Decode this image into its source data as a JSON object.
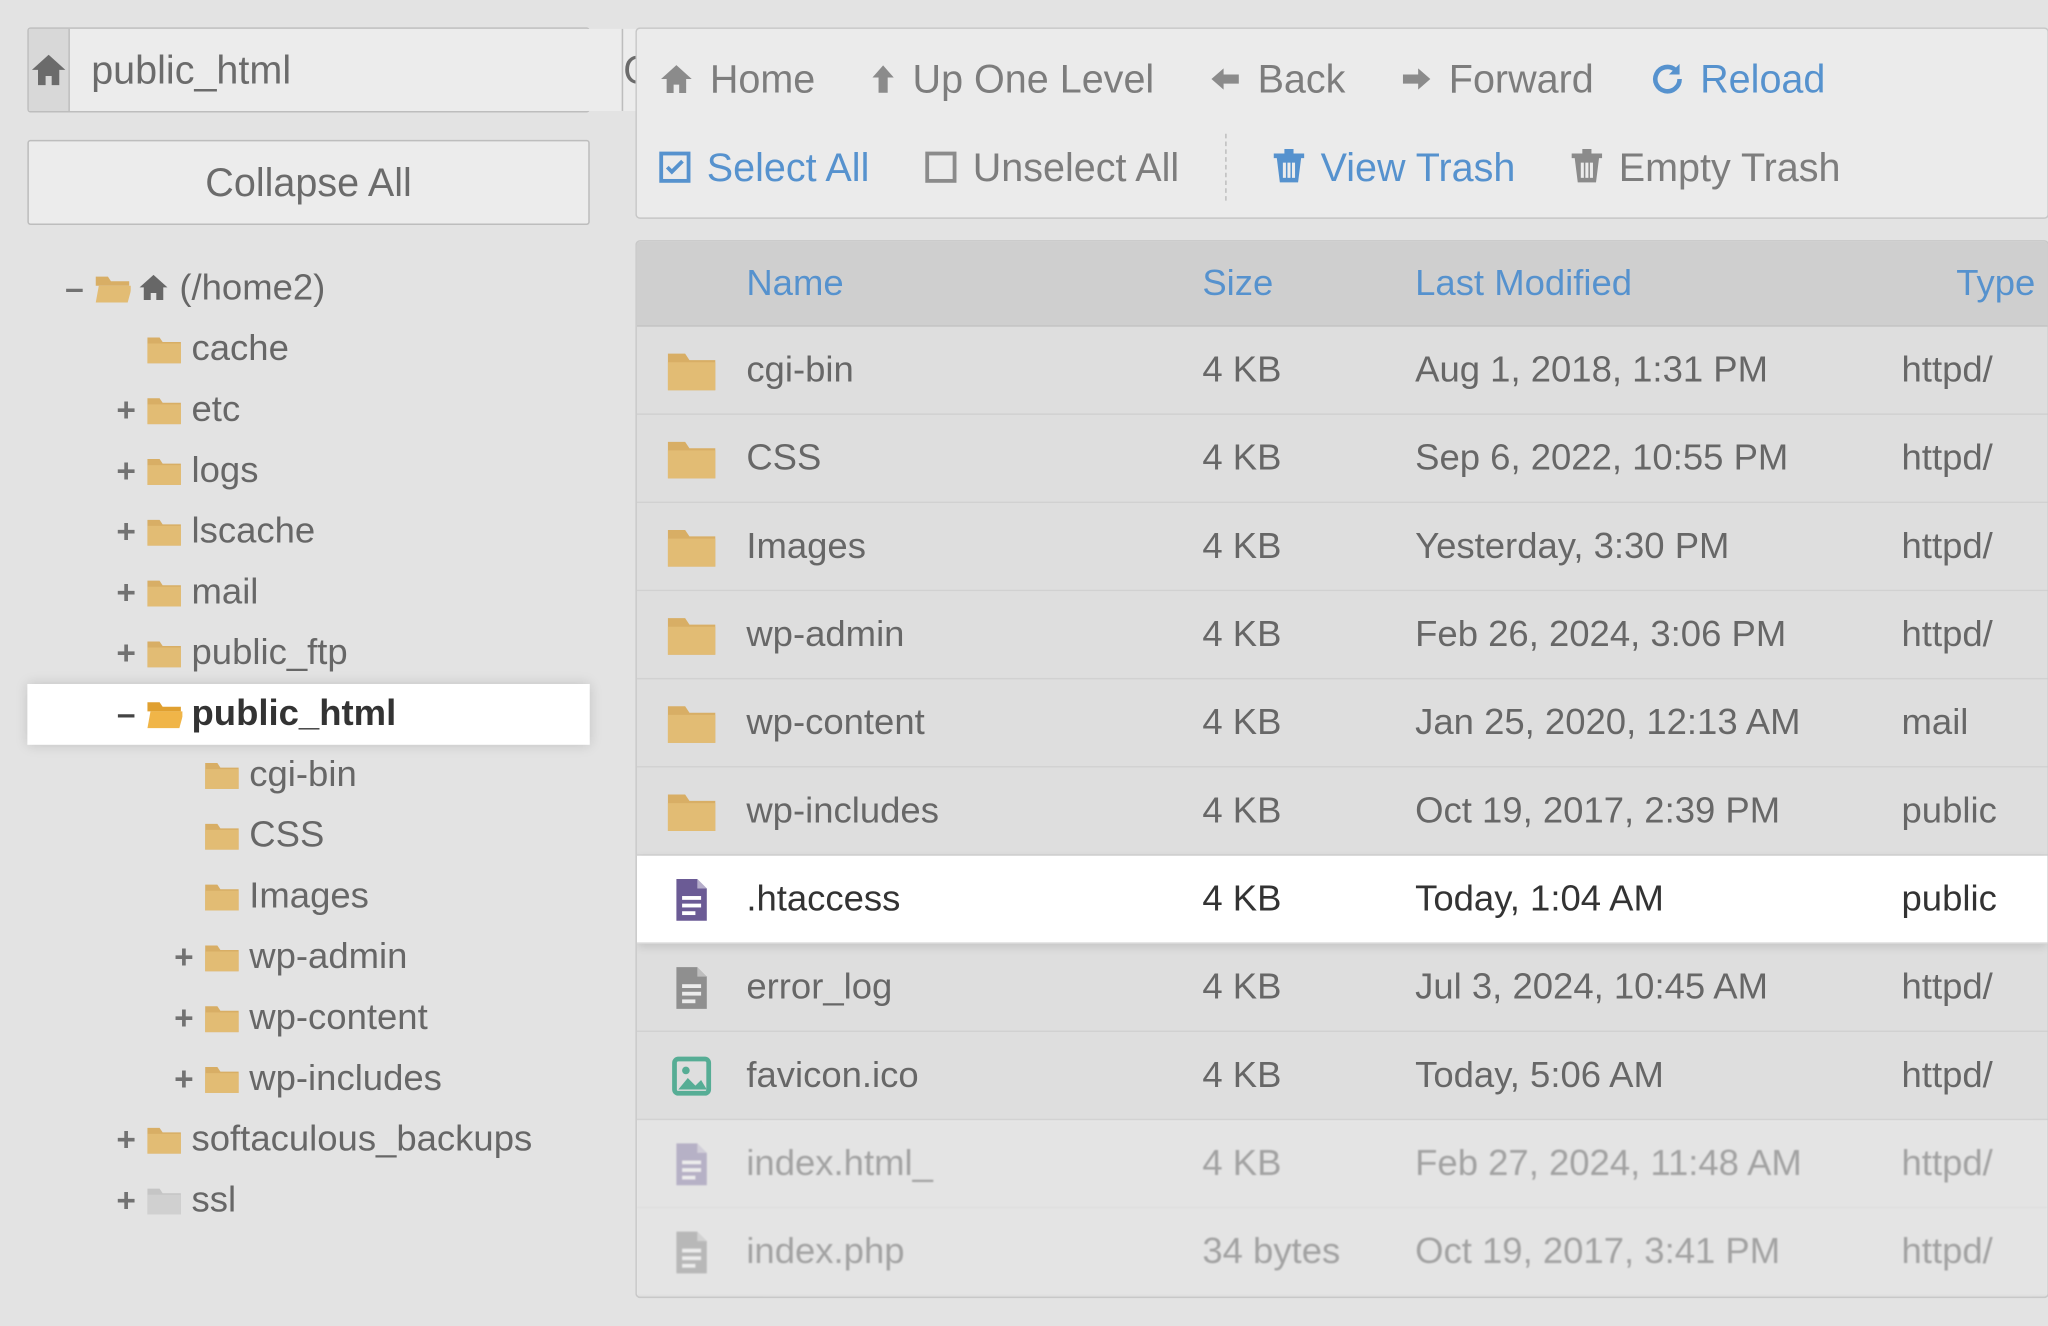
{
  "path_input": "public_html",
  "go_label": "Go",
  "collapse_all_label": "Collapse All",
  "toolbar": {
    "home": "Home",
    "up": "Up One Level",
    "back": "Back",
    "forward": "Forward",
    "reload": "Reload",
    "select_all": "Select All",
    "unselect_all": "Unselect All",
    "view_trash": "View Trash",
    "empty_trash": "Empty Trash"
  },
  "columns": {
    "name": "Name",
    "size": "Size",
    "modified": "Last Modified",
    "type": "Type"
  },
  "tree": [
    {
      "depth": 0,
      "toggle": "–",
      "icon": "folder-open-home",
      "label": "(/home2)"
    },
    {
      "depth": 1,
      "toggle": "",
      "icon": "folder",
      "label": "cache"
    },
    {
      "depth": 1,
      "toggle": "+",
      "icon": "folder",
      "label": "etc"
    },
    {
      "depth": 1,
      "toggle": "+",
      "icon": "folder",
      "label": "logs"
    },
    {
      "depth": 1,
      "toggle": "+",
      "icon": "folder",
      "label": "lscache"
    },
    {
      "depth": 1,
      "toggle": "+",
      "icon": "folder",
      "label": "mail"
    },
    {
      "depth": 1,
      "toggle": "+",
      "icon": "folder",
      "label": "public_ftp"
    },
    {
      "depth": 1,
      "toggle": "–",
      "icon": "folder-open",
      "label": "public_html",
      "bold": true,
      "highlight": true
    },
    {
      "depth": 2,
      "toggle": "",
      "icon": "folder",
      "label": "cgi-bin"
    },
    {
      "depth": 2,
      "toggle": "",
      "icon": "folder",
      "label": "CSS"
    },
    {
      "depth": 2,
      "toggle": "",
      "icon": "folder",
      "label": "Images"
    },
    {
      "depth": 2,
      "toggle": "+",
      "icon": "folder",
      "label": "wp-admin"
    },
    {
      "depth": 2,
      "toggle": "+",
      "icon": "folder",
      "label": "wp-content"
    },
    {
      "depth": 2,
      "toggle": "+",
      "icon": "folder",
      "label": "wp-includes"
    },
    {
      "depth": 1,
      "toggle": "+",
      "icon": "folder",
      "label": "softaculous_backups"
    },
    {
      "depth": 1,
      "toggle": "+",
      "icon": "folder-dim",
      "label": "ssl"
    }
  ],
  "rows": [
    {
      "icon": "folder",
      "name": "cgi-bin",
      "size": "4 KB",
      "modified": "Aug 1, 2018, 1:31 PM",
      "type": "httpd/"
    },
    {
      "icon": "folder",
      "name": "CSS",
      "size": "4 KB",
      "modified": "Sep 6, 2022, 10:55 PM",
      "type": "httpd/"
    },
    {
      "icon": "folder",
      "name": "Images",
      "size": "4 KB",
      "modified": "Yesterday, 3:30 PM",
      "type": "httpd/"
    },
    {
      "icon": "folder",
      "name": "wp-admin",
      "size": "4 KB",
      "modified": "Feb 26, 2024, 3:06 PM",
      "type": "httpd/"
    },
    {
      "icon": "folder",
      "name": "wp-content",
      "size": "4 KB",
      "modified": "Jan 25, 2020, 12:13 AM",
      "type": "mail"
    },
    {
      "icon": "folder",
      "name": "wp-includes",
      "size": "4 KB",
      "modified": "Oct 19, 2017, 2:39 PM",
      "type": "public"
    },
    {
      "icon": "doc-purple",
      "name": ".htaccess",
      "size": "4 KB",
      "modified": "Today, 1:04 AM",
      "type": "public",
      "highlight": true
    },
    {
      "icon": "doc-gray",
      "name": "error_log",
      "size": "4 KB",
      "modified": "Jul 3, 2024, 10:45 AM",
      "type": "httpd/"
    },
    {
      "icon": "image",
      "name": "favicon.ico",
      "size": "4 KB",
      "modified": "Today, 5:06 AM",
      "type": "httpd/"
    },
    {
      "icon": "doc-purple",
      "name": "index.html_",
      "size": "4 KB",
      "modified": "Feb 27, 2024, 11:48 AM",
      "type": "httpd/",
      "faded": true
    },
    {
      "icon": "doc-gray",
      "name": "index.php",
      "size": "34 bytes",
      "modified": "Oct 19, 2017, 3:41 PM",
      "type": "httpd/",
      "faded": true
    }
  ]
}
